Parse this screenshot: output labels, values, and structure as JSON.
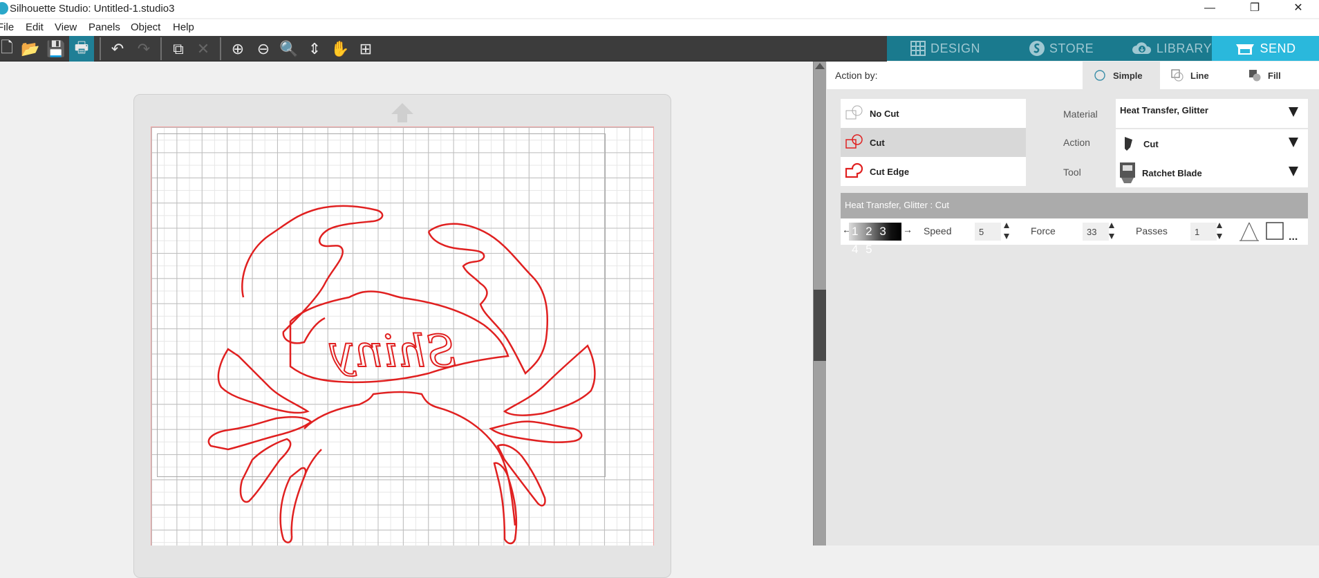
{
  "window": {
    "title": "Silhouette Studio: Untitled-1.studio3",
    "minimize_label": "—",
    "restore_label": "❐",
    "close_label": "✕"
  },
  "menu": {
    "items": [
      "File",
      "Edit",
      "View",
      "Panels",
      "Object",
      "Help"
    ]
  },
  "toolbar": {
    "buttons": [
      {
        "name": "new",
        "glyph": "🗋"
      },
      {
        "name": "open",
        "glyph": "📂"
      },
      {
        "name": "save",
        "glyph": "💾"
      },
      {
        "name": "send-to-print",
        "glyph": "🖶"
      },
      {
        "name": "undo",
        "glyph": "↶"
      },
      {
        "name": "redo",
        "glyph": "↷"
      },
      {
        "name": "select-all",
        "glyph": "⧉"
      },
      {
        "name": "delete",
        "glyph": "✕"
      },
      {
        "name": "zoom-in",
        "glyph": "⊕"
      },
      {
        "name": "zoom-out",
        "glyph": "⊖"
      },
      {
        "name": "zoom-select",
        "glyph": "🔍"
      },
      {
        "name": "drag-zoom",
        "glyph": "⇕"
      },
      {
        "name": "pan",
        "glyph": "✋"
      },
      {
        "name": "fit-to-page",
        "glyph": "⊞"
      }
    ]
  },
  "nav": {
    "tabs": [
      {
        "label": "DESIGN",
        "active": false
      },
      {
        "label": "STORE",
        "active": false
      },
      {
        "label": "LIBRARY",
        "active": false
      },
      {
        "label": "SEND",
        "active": true
      }
    ]
  },
  "canvas": {
    "design_text": "Shiny",
    "design_shape": "crab",
    "design_mirrored": true,
    "cut_line_color": "#e02020"
  },
  "panel": {
    "action_by_label": "Action by:",
    "modes": [
      {
        "label": "Simple",
        "active": true
      },
      {
        "label": "Line",
        "active": false
      },
      {
        "label": "Fill",
        "active": false
      }
    ],
    "cut_options": [
      {
        "label": "No Cut",
        "active": false
      },
      {
        "label": "Cut",
        "active": true
      },
      {
        "label": "Cut Edge",
        "active": false
      }
    ],
    "material_label": "Material",
    "material_value": "Heat Transfer, Glitter",
    "action_label": "Action",
    "action_value": "Cut",
    "tool_label": "Tool",
    "tool_value": "Ratchet Blade",
    "summary": "Heat Transfer, Glitter : Cut",
    "blade_depth_digits": "1 2 3 4 5",
    "speed_label": "Speed",
    "speed_value": "5",
    "force_label": "Force",
    "force_value": "33",
    "passes_label": "Passes",
    "passes_value": "1",
    "more_label": "..."
  },
  "colors": {
    "accent_teal": "#1a7a8e",
    "active_tab": "#2ab8dc",
    "cut_red": "#e02020"
  }
}
